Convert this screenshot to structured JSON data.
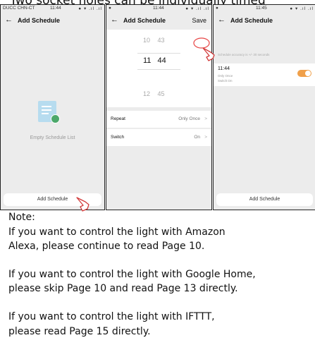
{
  "heading": "Two socket holes can be individually timed",
  "status_bar_1": {
    "carrier": "DUCC CHN-CT",
    "time": "11:44",
    "icons": "● ▾ .ıl .ıl"
  },
  "status_bar_2": {
    "carrier": "●",
    "time": "11:44",
    "icons": "● ▾ .ıl .ıl"
  },
  "status_bar_3": {
    "carrier": "●",
    "time": "11:45",
    "icons": "● ▾ .ıl .ıl"
  },
  "screen1": {
    "back": "←",
    "title": "Add Schedule",
    "empty_text": "Empty Schedule List",
    "button": "Add Schedule"
  },
  "screen2": {
    "back": "←",
    "title": "Add Schedule",
    "save": "Save",
    "time_rows": [
      {
        "h": "10",
        "m": "43"
      },
      {
        "h": "11",
        "m": "44"
      },
      {
        "h": "12",
        "m": "45"
      }
    ],
    "repeat_label": "Repeat",
    "repeat_value": "Only Once",
    "switch_label": "Switch",
    "switch_value": "On",
    "chevron": ">"
  },
  "screen3": {
    "back": "←",
    "title": "Add Schedule",
    "hint": "Schedule accuracy is +/- 30 seconds",
    "time": "11:44",
    "repeat": "Only Once",
    "switch": "Switch:On",
    "button": "Add Schedule"
  },
  "note": {
    "title": "Note:",
    "line1": "If you want to control the light with Amazon",
    "line2": "Alexa, please continue to read Page 10.",
    "line3": "If you want to control the light with Google Home,",
    "line4": "please skip Page 10 and read Page 13 directly.",
    "line5": "If you want to control the light with IFTTT,",
    "line6": "please read Page 15 directly."
  },
  "colors": {
    "toggle": "#f0a04a",
    "save_highlight": "#e84646",
    "doc_icon": "#b7dcef"
  }
}
